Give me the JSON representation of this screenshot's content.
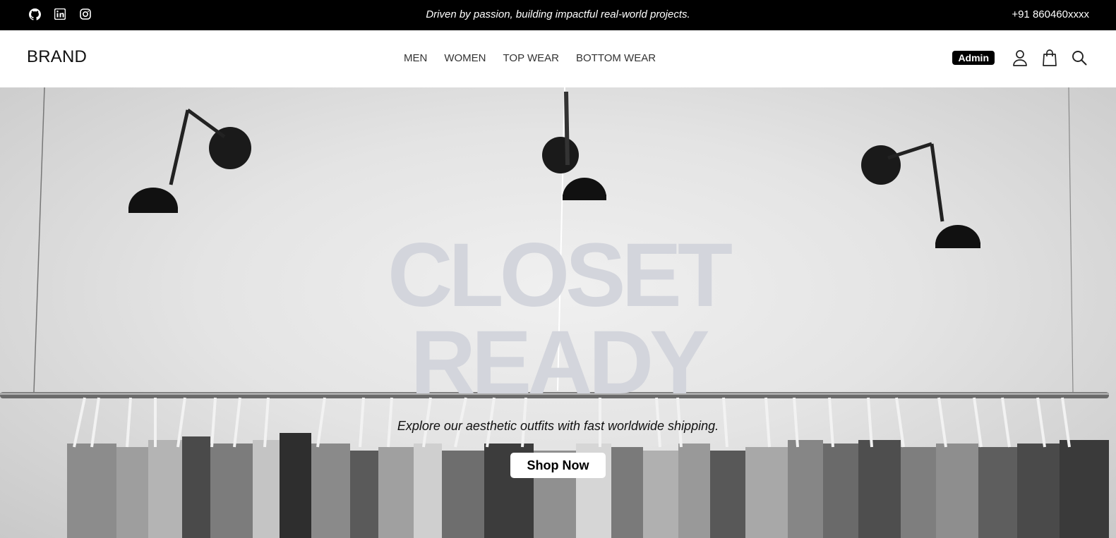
{
  "topbar": {
    "social_icons": [
      "github-icon",
      "linkedin-icon",
      "instagram-icon"
    ],
    "tagline": "Driven by passion, building impactful real-world projects.",
    "phone": "+91 860460xxxx"
  },
  "header": {
    "brand": "BRAND",
    "nav": [
      {
        "label": "MEN"
      },
      {
        "label": "WOMEN"
      },
      {
        "label": "TOP WEAR"
      },
      {
        "label": "BOTTOM WEAR"
      }
    ],
    "admin_label": "Admin",
    "icons": [
      "user-icon",
      "shopping-bag-icon",
      "search-icon"
    ]
  },
  "hero": {
    "title_line1": "CLOSET",
    "title_line2": "READY",
    "subtitle": "Explore our aesthetic outfits with fast worldwide shipping.",
    "cta_label": "Shop Now"
  },
  "colors": {
    "topbar_bg": "#000000",
    "hero_title": "#d3d5dc",
    "accent": "#000000"
  }
}
